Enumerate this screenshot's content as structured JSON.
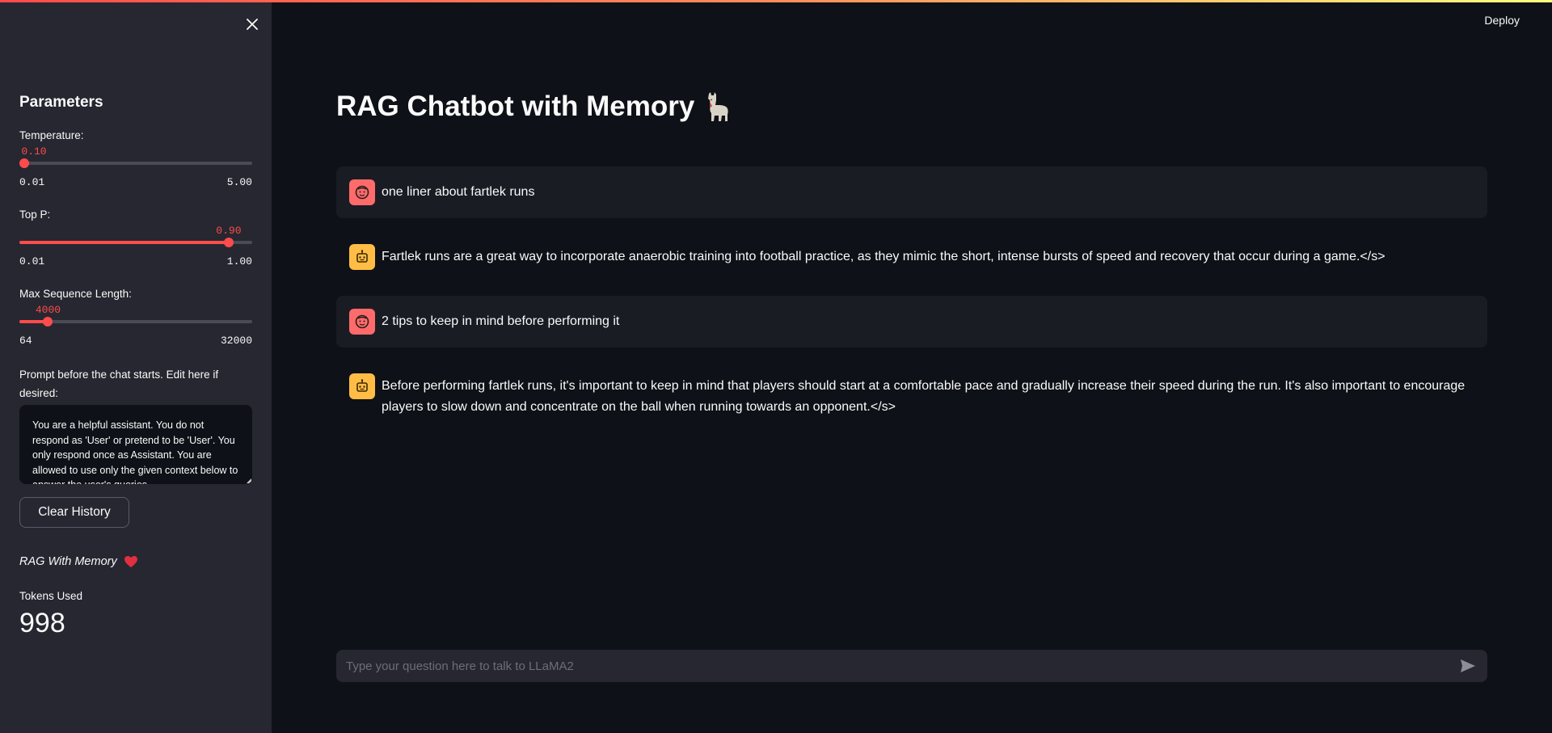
{
  "header": {
    "deploy_label": "Deploy"
  },
  "sidebar": {
    "heading": "Parameters",
    "sliders": [
      {
        "label": "Temperature:",
        "value_text": "0.10",
        "value": 0.1,
        "min": 0.01,
        "max": 5.0,
        "min_text": "0.01",
        "max_text": "5.00"
      },
      {
        "label": "Top P:",
        "value_text": "0.90",
        "value": 0.9,
        "min": 0.01,
        "max": 1.0,
        "min_text": "0.01",
        "max_text": "1.00"
      },
      {
        "label": "Max Sequence Length:",
        "value_text": "4000",
        "value": 4000,
        "min": 64,
        "max": 32000,
        "min_text": "64",
        "max_text": "32000"
      }
    ],
    "prompt_label": "Prompt before the chat starts. Edit here if desired:",
    "prompt_text": "You are a helpful assistant. You do not respond as 'User' or pretend to be 'User'. You only respond once as Assistant. You are allowed to use only the given context below to answer the user's queries,",
    "clear_button": "Clear History",
    "footer_note": "RAG With Memory",
    "tokens_label": "Tokens Used",
    "tokens_value": "998"
  },
  "main": {
    "title": "RAG Chatbot with Memory",
    "messages": [
      {
        "role": "user",
        "text": "one liner about fartlek runs"
      },
      {
        "role": "assistant",
        "text": "Fartlek runs are a great way to incorporate anaerobic training into football practice, as they mimic the short, intense bursts of speed and recovery that occur during a game.</s>"
      },
      {
        "role": "user",
        "text": "2 tips to keep in mind before performing it"
      },
      {
        "role": "assistant",
        "text": "Before performing fartlek runs, it's important to keep in mind that players should start at a comfortable pace and gradually increase their speed during the run. It's also important to encourage players to slow down and concentrate on the ball when running towards an opponent.</s>"
      }
    ],
    "chat_input_placeholder": "Type your question here to talk to LLaMA2"
  },
  "icons": {
    "close": "close-icon",
    "user_avatar": "user-face-icon",
    "assistant_avatar": "robot-icon",
    "title_emoji": "llama-icon",
    "heart": "heart-icon",
    "send": "send-icon"
  },
  "colors": {
    "accent": "#ff4b4b",
    "sidebar_bg": "#262730",
    "main_bg": "#0e1117",
    "user_avatar": "#ff6b6b",
    "assistant_avatar": "#ffbd45"
  }
}
